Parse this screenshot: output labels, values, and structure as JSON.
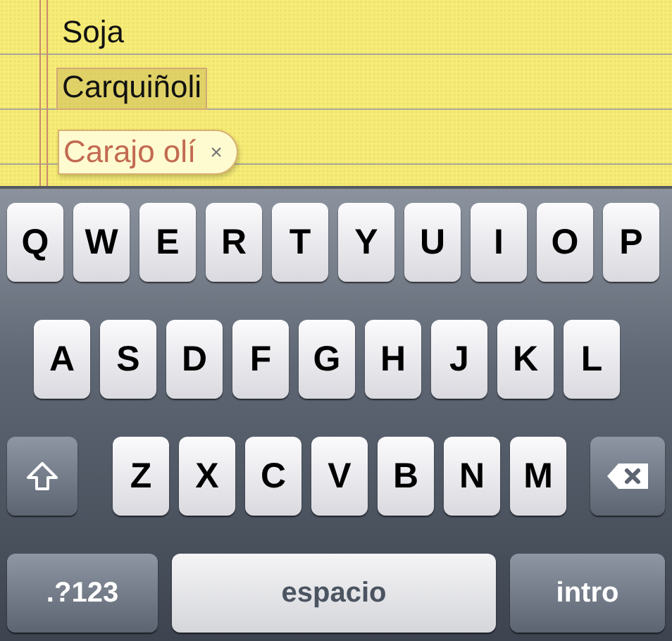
{
  "note": {
    "lines": [
      {
        "text": "Soja",
        "highlighted": false
      },
      {
        "text": "Carquiñoli",
        "highlighted": true
      }
    ],
    "suggestion": {
      "text": "Carajo olí",
      "close": "×"
    }
  },
  "keyboard": {
    "rows": [
      {
        "keys": [
          {
            "kind": "letter",
            "label": "Q"
          },
          {
            "kind": "letter",
            "label": "W"
          },
          {
            "kind": "letter",
            "label": "E"
          },
          {
            "kind": "letter",
            "label": "R"
          },
          {
            "kind": "letter",
            "label": "T"
          },
          {
            "kind": "letter",
            "label": "Y"
          },
          {
            "kind": "letter",
            "label": "U"
          },
          {
            "kind": "letter",
            "label": "I"
          },
          {
            "kind": "letter",
            "label": "O"
          },
          {
            "kind": "letter",
            "label": "P"
          }
        ]
      },
      {
        "keys": [
          {
            "kind": "letter",
            "label": "A"
          },
          {
            "kind": "letter",
            "label": "S"
          },
          {
            "kind": "letter",
            "label": "D"
          },
          {
            "kind": "letter",
            "label": "F"
          },
          {
            "kind": "letter",
            "label": "G"
          },
          {
            "kind": "letter",
            "label": "H"
          },
          {
            "kind": "letter",
            "label": "J"
          },
          {
            "kind": "letter",
            "label": "K"
          },
          {
            "kind": "letter",
            "label": "L"
          }
        ]
      },
      {
        "keys": [
          {
            "kind": "shift"
          },
          {
            "kind": "letter",
            "label": "Z"
          },
          {
            "kind": "letter",
            "label": "X"
          },
          {
            "kind": "letter",
            "label": "C"
          },
          {
            "kind": "letter",
            "label": "V"
          },
          {
            "kind": "letter",
            "label": "B"
          },
          {
            "kind": "letter",
            "label": "N"
          },
          {
            "kind": "letter",
            "label": "M"
          },
          {
            "kind": "delete"
          }
        ]
      },
      {
        "keys": [
          {
            "kind": "mode",
            "label": ".?123"
          },
          {
            "kind": "space",
            "label": "espacio"
          },
          {
            "kind": "return",
            "label": "intro"
          }
        ]
      }
    ]
  }
}
